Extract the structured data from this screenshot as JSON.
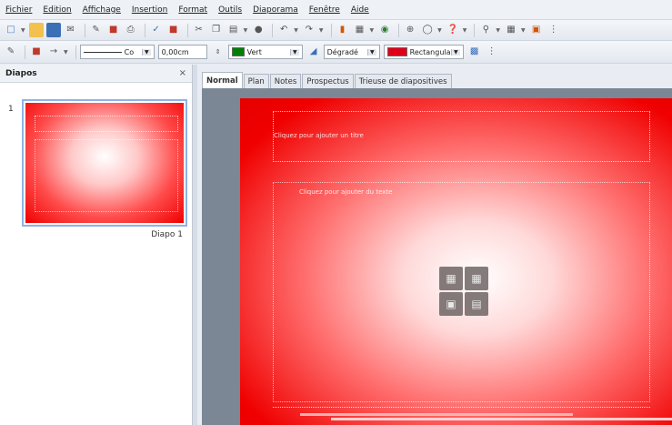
{
  "menu": [
    "Fichier",
    "Edition",
    "Affichage",
    "Insertion",
    "Format",
    "Outils",
    "Diaporama",
    "Fenêtre",
    "Aide"
  ],
  "toolbar2": {
    "line_style": "Co",
    "line_width": "0,00cm",
    "area_color": "Vert",
    "area_fill_type": "Dégradé",
    "area_fill_style": "Rectangula"
  },
  "colors": {
    "area_color_swatch": "#008000",
    "fill_style_swatch": "#e0001a",
    "slide_red": "#f00000"
  },
  "slides_panel": {
    "title": "Diapos",
    "close": "×",
    "slide_number": "1",
    "thumb_label": "Diapo 1"
  },
  "view_tabs": [
    "Normal",
    "Plan",
    "Notes",
    "Prospectus",
    "Trieuse de diapositives"
  ],
  "slide": {
    "title_placeholder": "Cliquez pour ajouter un titre",
    "content_placeholder": "Cliquez pour ajouter du texte"
  }
}
